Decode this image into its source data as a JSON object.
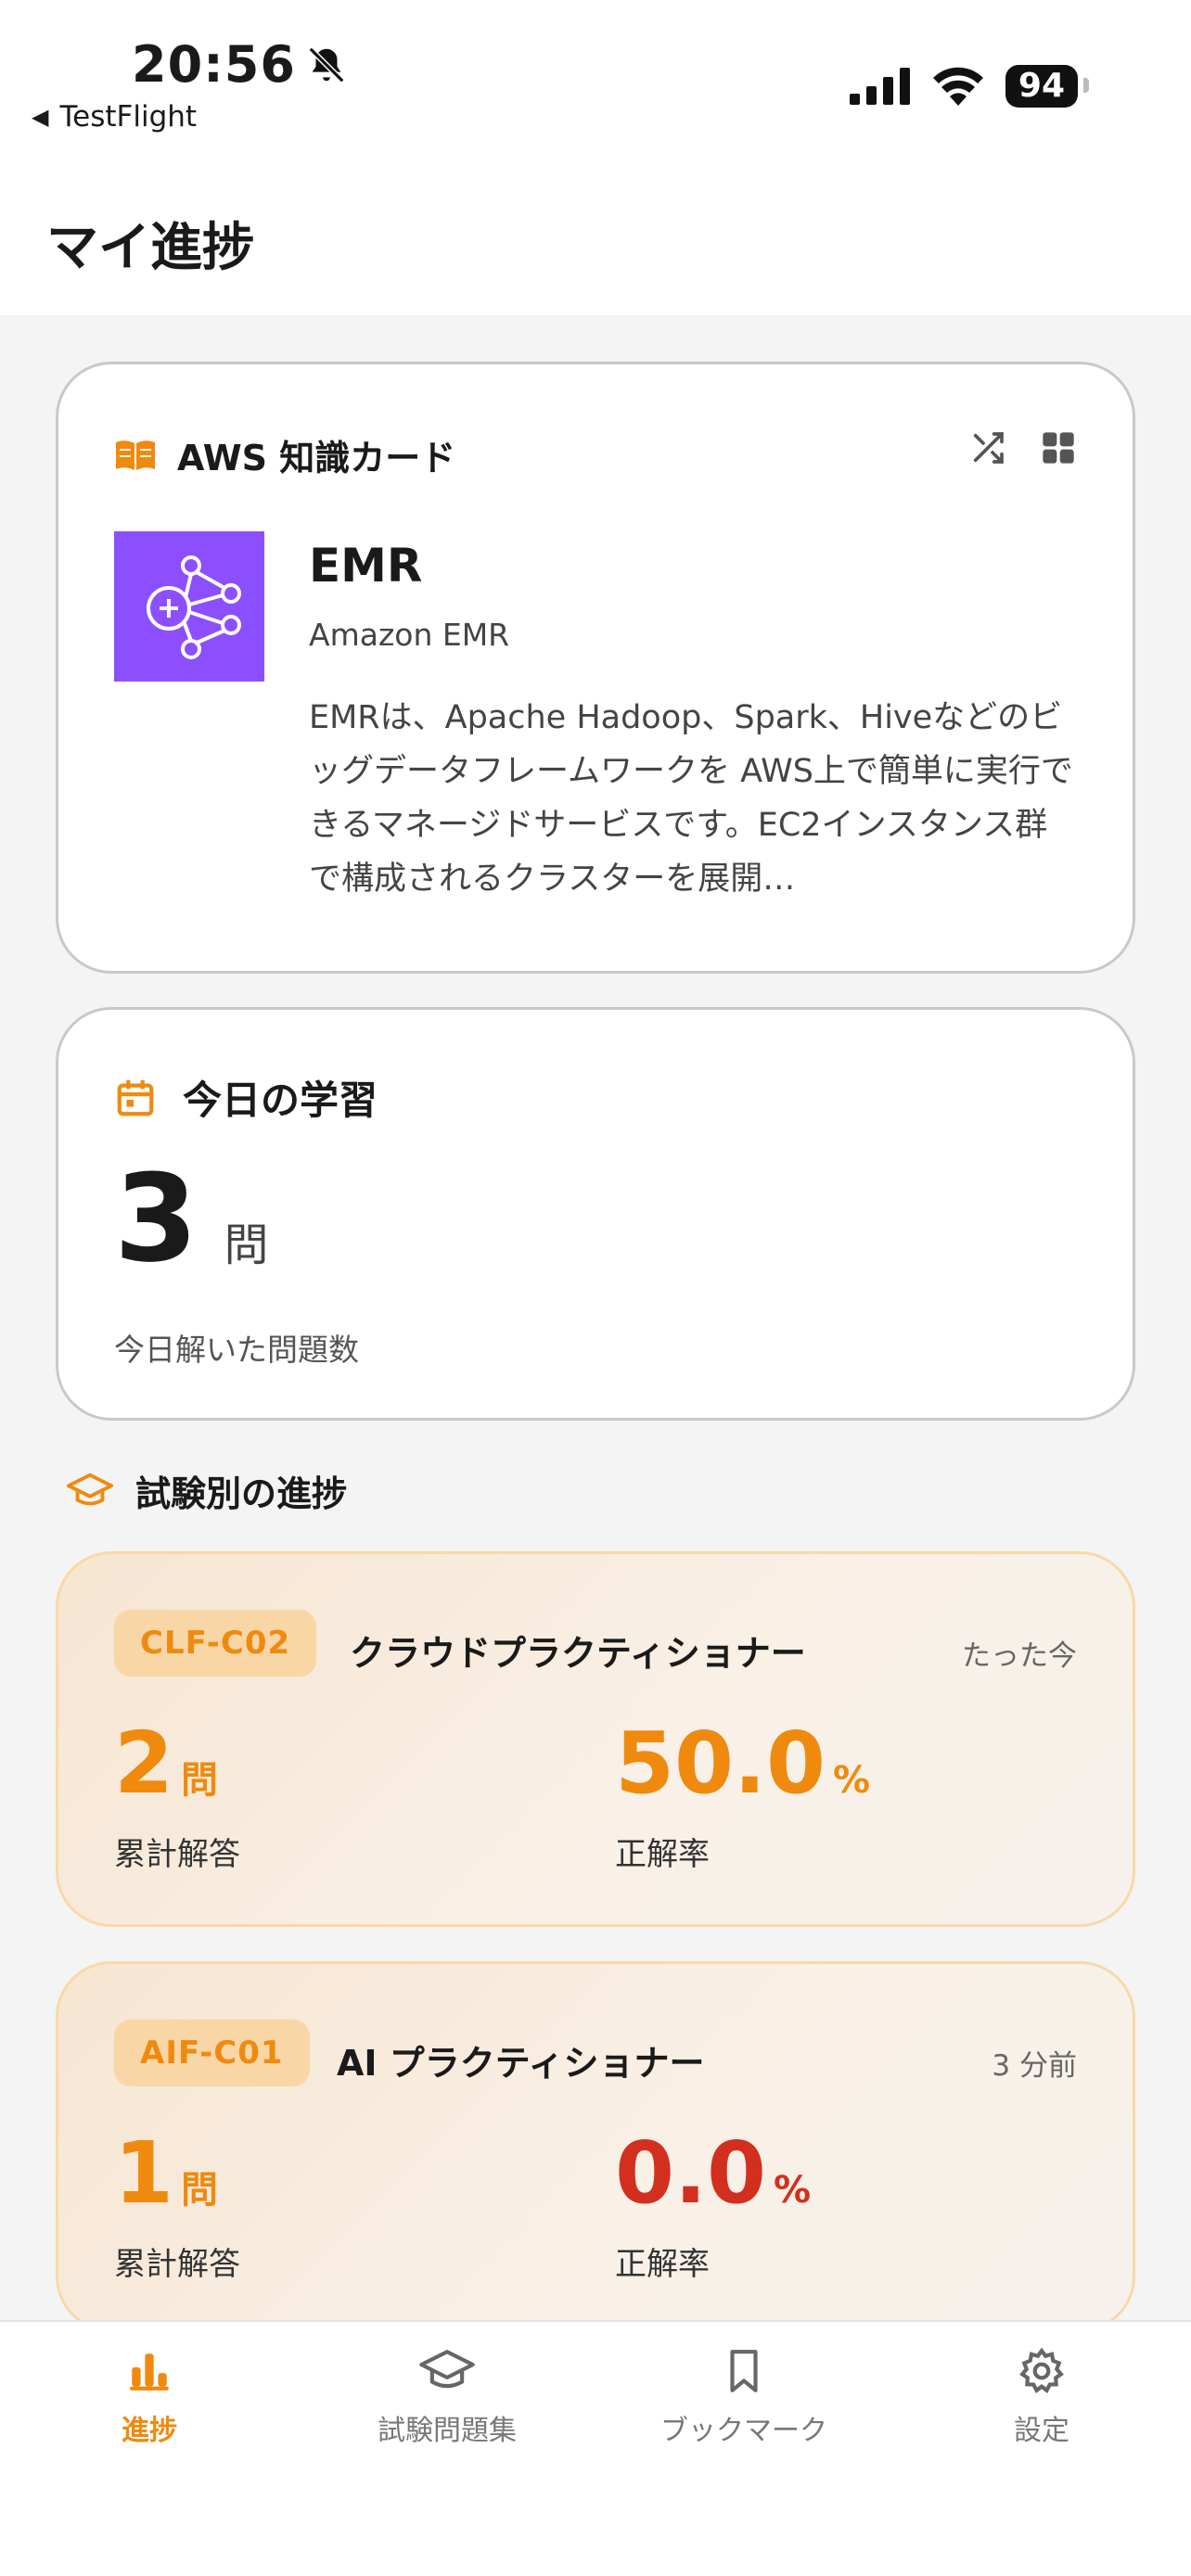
{
  "status_bar": {
    "time": "20:56",
    "back_app": "TestFlight",
    "battery": "94"
  },
  "header": {
    "title": "マイ進捗"
  },
  "knowledge_card": {
    "title": "AWS 知識カード",
    "service_name": "EMR",
    "service_full_name": "Amazon EMR",
    "description": "EMRは、Apache Hadoop、Spark、Hiveなどのビッグデータフレームワークを AWS上で簡単に実行できるマネージドサービスです。EC2インスタンス群で構成されるクラスターを展開…",
    "logo_color": "#8c4fff"
  },
  "today": {
    "title": "今日の学習",
    "count": "3",
    "unit": "問",
    "subtitle": "今日解いた問題数"
  },
  "exam_section": {
    "title": "試験別の進捗"
  },
  "exams": [
    {
      "code": "CLF-C02",
      "name": "クラウドプラクティショナー",
      "time": "たった今",
      "answered": "2",
      "answered_unit": "問",
      "answered_label": "累計解答",
      "accuracy": "50.0",
      "accuracy_unit": "%",
      "accuracy_label": "正解率"
    },
    {
      "code": "AIF-C01",
      "name": "AI プラクティショナー",
      "time": "3 分前",
      "answered": "1",
      "answered_unit": "問",
      "answered_label": "累計解答",
      "accuracy": "0.0",
      "accuracy_unit": "%",
      "accuracy_label": "正解率"
    }
  ],
  "tabs": [
    {
      "label": "進捗",
      "icon": "bar-chart-icon",
      "active": true
    },
    {
      "label": "試験問題集",
      "icon": "graduation-cap-icon",
      "active": false
    },
    {
      "label": "ブックマーク",
      "icon": "bookmark-icon",
      "active": false
    },
    {
      "label": "設定",
      "icon": "gear-icon",
      "active": false
    }
  ],
  "colors": {
    "accent": "#ef8a0f",
    "danger": "#d32f1e",
    "badge_bg": "#f9d6a6"
  }
}
